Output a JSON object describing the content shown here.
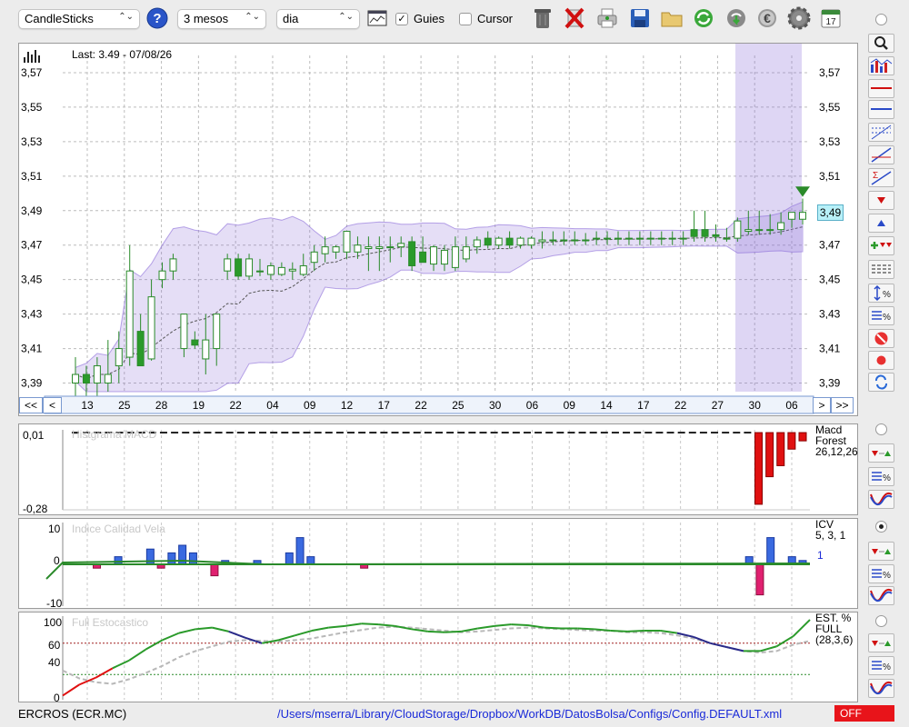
{
  "toolbar": {
    "chart_type": "CandleSticks",
    "period": "3 mesos",
    "interval": "dia",
    "guides_label": "Guies",
    "guides_checked": true,
    "cursor_label": "Cursor",
    "cursor_checked": false,
    "calendar_day": "17",
    "icons": [
      "help-icon",
      "chart-settings-icon",
      "trash-icon",
      "delete-icon",
      "print-icon",
      "save-icon",
      "folder-icon",
      "refresh-icon",
      "download-icon",
      "euro-icon",
      "gear-icon",
      "calendar-icon"
    ]
  },
  "main_chart": {
    "last_label": "Last: 3.49 - 07/08/26",
    "current_price": "3,49",
    "nav": {
      "first": "<<",
      "prev": "<",
      "next": ">",
      "last": ">>"
    }
  },
  "chart_data": [
    {
      "type": "candlestick",
      "name": "ERCROS (ECR.MC)",
      "ylim": [
        3.385,
        3.58
      ],
      "y_ticks": [
        "3,57",
        "3,55",
        "3,53",
        "3,51",
        "3,49",
        "3,47",
        "3,45",
        "3,43",
        "3,41",
        "3,39"
      ],
      "x_labels": [
        "13",
        "25",
        "28",
        "19",
        "22",
        "04",
        "09",
        "12",
        "17",
        "22",
        "25",
        "30",
        "06",
        "09",
        "14",
        "17",
        "22",
        "27",
        "30",
        "06"
      ],
      "candles": [
        {
          "o": 3.39,
          "h": 3.405,
          "l": 3.38,
          "c": 3.395
        },
        {
          "o": 3.395,
          "h": 3.4,
          "l": 3.378,
          "c": 3.39
        },
        {
          "o": 3.39,
          "h": 3.405,
          "l": 3.375,
          "c": 3.4
        },
        {
          "o": 3.39,
          "h": 3.415,
          "l": 3.385,
          "c": 3.395
        },
        {
          "o": 3.4,
          "h": 3.42,
          "l": 3.39,
          "c": 3.41
        },
        {
          "o": 3.405,
          "h": 3.47,
          "l": 3.4,
          "c": 3.455
        },
        {
          "o": 3.42,
          "h": 3.43,
          "l": 3.4,
          "c": 3.4
        },
        {
          "o": 3.404,
          "h": 3.45,
          "l": 3.403,
          "c": 3.44
        },
        {
          "o": 3.45,
          "h": 3.46,
          "l": 3.445,
          "c": 3.455
        },
        {
          "o": 3.455,
          "h": 3.465,
          "l": 3.45,
          "c": 3.462
        },
        {
          "o": 3.41,
          "h": 3.43,
          "l": 3.405,
          "c": 3.43
        },
        {
          "o": 3.415,
          "h": 3.42,
          "l": 3.41,
          "c": 3.412
        },
        {
          "o": 3.404,
          "h": 3.43,
          "l": 3.395,
          "c": 3.415
        },
        {
          "o": 3.41,
          "h": 3.43,
          "l": 3.4,
          "c": 3.43
        },
        {
          "o": 3.455,
          "h": 3.465,
          "l": 3.45,
          "c": 3.462
        },
        {
          "o": 3.462,
          "h": 3.465,
          "l": 3.45,
          "c": 3.452
        },
        {
          "o": 3.452,
          "h": 3.465,
          "l": 3.45,
          "c": 3.462
        },
        {
          "o": 3.455,
          "h": 3.462,
          "l": 3.452,
          "c": 3.455
        },
        {
          "o": 3.453,
          "h": 3.46,
          "l": 3.45,
          "c": 3.458
        },
        {
          "o": 3.453,
          "h": 3.46,
          "l": 3.452,
          "c": 3.457
        },
        {
          "o": 3.455,
          "h": 3.46,
          "l": 3.45,
          "c": 3.456
        },
        {
          "o": 3.453,
          "h": 3.465,
          "l": 3.452,
          "c": 3.458
        },
        {
          "o": 3.46,
          "h": 3.47,
          "l": 3.455,
          "c": 3.466
        },
        {
          "o": 3.465,
          "h": 3.475,
          "l": 3.46,
          "c": 3.469
        },
        {
          "o": 3.466,
          "h": 3.47,
          "l": 3.462,
          "c": 3.469
        },
        {
          "o": 3.466,
          "h": 3.475,
          "l": 3.462,
          "c": 3.478
        },
        {
          "o": 3.466,
          "h": 3.475,
          "l": 3.462,
          "c": 3.47
        },
        {
          "o": 3.468,
          "h": 3.475,
          "l": 3.455,
          "c": 3.469
        },
        {
          "o": 3.468,
          "h": 3.475,
          "l": 3.455,
          "c": 3.469
        },
        {
          "o": 3.469,
          "h": 3.475,
          "l": 3.46,
          "c": 3.469
        },
        {
          "o": 3.469,
          "h": 3.475,
          "l": 3.463,
          "c": 3.471
        },
        {
          "o": 3.472,
          "h": 3.475,
          "l": 3.455,
          "c": 3.458
        },
        {
          "o": 3.466,
          "h": 3.475,
          "l": 3.462,
          "c": 3.46
        },
        {
          "o": 3.459,
          "h": 3.47,
          "l": 3.455,
          "c": 3.469
        },
        {
          "o": 3.459,
          "h": 3.47,
          "l": 3.455,
          "c": 3.467
        },
        {
          "o": 3.457,
          "h": 3.475,
          "l": 3.455,
          "c": 3.469
        },
        {
          "o": 3.462,
          "h": 3.475,
          "l": 3.46,
          "c": 3.469
        },
        {
          "o": 3.469,
          "h": 3.475,
          "l": 3.465,
          "c": 3.473
        },
        {
          "o": 3.474,
          "h": 3.478,
          "l": 3.468,
          "c": 3.47
        },
        {
          "o": 3.47,
          "h": 3.475,
          "l": 3.468,
          "c": 3.474
        },
        {
          "o": 3.474,
          "h": 3.478,
          "l": 3.468,
          "c": 3.47
        },
        {
          "o": 3.47,
          "h": 3.475,
          "l": 3.468,
          "c": 3.474
        },
        {
          "o": 3.47,
          "h": 3.475,
          "l": 3.468,
          "c": 3.474
        },
        {
          "o": 3.472,
          "h": 3.478,
          "l": 3.468,
          "c": 3.473
        },
        {
          "o": 3.473,
          "h": 3.478,
          "l": 3.47,
          "c": 3.473
        },
        {
          "o": 3.473,
          "h": 3.478,
          "l": 3.47,
          "c": 3.473
        },
        {
          "o": 3.473,
          "h": 3.478,
          "l": 3.47,
          "c": 3.473
        },
        {
          "o": 3.473,
          "h": 3.477,
          "l": 3.47,
          "c": 3.473
        },
        {
          "o": 3.474,
          "h": 3.478,
          "l": 3.47,
          "c": 3.474
        },
        {
          "o": 3.474,
          "h": 3.478,
          "l": 3.47,
          "c": 3.474
        },
        {
          "o": 3.474,
          "h": 3.478,
          "l": 3.47,
          "c": 3.474
        },
        {
          "o": 3.474,
          "h": 3.478,
          "l": 3.47,
          "c": 3.474
        },
        {
          "o": 3.474,
          "h": 3.478,
          "l": 3.47,
          "c": 3.474
        },
        {
          "o": 3.474,
          "h": 3.478,
          "l": 3.47,
          "c": 3.474
        },
        {
          "o": 3.474,
          "h": 3.478,
          "l": 3.47,
          "c": 3.474
        },
        {
          "o": 3.474,
          "h": 3.478,
          "l": 3.47,
          "c": 3.474
        },
        {
          "o": 3.474,
          "h": 3.478,
          "l": 3.47,
          "c": 3.474
        },
        {
          "o": 3.479,
          "h": 3.49,
          "l": 3.472,
          "c": 3.475
        },
        {
          "o": 3.479,
          "h": 3.49,
          "l": 3.472,
          "c": 3.475
        },
        {
          "o": 3.476,
          "h": 3.482,
          "l": 3.472,
          "c": 3.475
        },
        {
          "o": 3.474,
          "h": 3.48,
          "l": 3.472,
          "c": 3.474
        },
        {
          "o": 3.474,
          "h": 3.486,
          "l": 3.472,
          "c": 3.484
        },
        {
          "o": 3.478,
          "h": 3.49,
          "l": 3.476,
          "c": 3.479
        },
        {
          "o": 3.479,
          "h": 3.49,
          "l": 3.476,
          "c": 3.479
        },
        {
          "o": 3.479,
          "h": 3.488,
          "l": 3.476,
          "c": 3.479
        },
        {
          "o": 3.479,
          "h": 3.489,
          "l": 3.476,
          "c": 3.483
        },
        {
          "o": 3.485,
          "h": 3.489,
          "l": 3.48,
          "c": 3.489
        },
        {
          "o": 3.485,
          "h": 3.497,
          "l": 3.482,
          "c": 3.489
        }
      ],
      "sma_color": "#555555",
      "band_color": "#8a6bd8"
    },
    {
      "type": "bar",
      "name": "Histgrama MACD",
      "legend": [
        "Macd",
        "Forest",
        "26,12,26"
      ],
      "ylim": [
        -0.28,
        0.01
      ],
      "y_ticks": [
        "0,01",
        "-0,28"
      ],
      "values": [
        0,
        0,
        0,
        0,
        0,
        0,
        0,
        0,
        0,
        0,
        0,
        0,
        0,
        0,
        0,
        0,
        0,
        0,
        0,
        0,
        0,
        0,
        0,
        0,
        0,
        0,
        0,
        0,
        0,
        0,
        0,
        0,
        0,
        0,
        0,
        0,
        0,
        0,
        0,
        0,
        0,
        0,
        0,
        0,
        0,
        0,
        0,
        0,
        0,
        0,
        0,
        0,
        0,
        0,
        0,
        0,
        0,
        0,
        0,
        0,
        0,
        0,
        -0.26,
        -0.16,
        -0.12,
        -0.06,
        -0.03
      ]
    },
    {
      "type": "bar",
      "name": "Índice Calidad Vela",
      "legend": [
        "ICV",
        "5, 3, 1"
      ],
      "secondary_label": "1",
      "ylim": [
        -10,
        10
      ],
      "y_ticks": [
        "10",
        "0",
        "-10"
      ],
      "values": [
        0,
        0,
        -1,
        0,
        2,
        0,
        0,
        4,
        -1,
        3,
        5,
        3,
        0,
        -3,
        1,
        0,
        0,
        1,
        0,
        0,
        3,
        7,
        2,
        0,
        0,
        0,
        0,
        -1,
        0,
        0,
        0,
        0,
        0,
        0,
        0,
        0,
        0,
        0,
        0,
        0,
        0,
        0,
        0,
        0,
        0,
        0,
        0,
        0,
        0,
        0,
        0,
        0,
        0,
        0,
        0,
        0,
        0,
        0,
        0,
        0,
        0,
        0,
        0,
        2,
        -8,
        7,
        0,
        2,
        1
      ]
    },
    {
      "type": "line",
      "name": "Full Estocástico",
      "legend": [
        "EST. %",
        "FULL",
        "(28,3,6)"
      ],
      "ylim": [
        0,
        100
      ],
      "y_ticks": [
        "100",
        "60",
        "40",
        "0"
      ],
      "series": [
        {
          "values": [
            3,
            17,
            26,
            38,
            48,
            62,
            74,
            83,
            88,
            90,
            85,
            77,
            70,
            74,
            80,
            86,
            90,
            92,
            95,
            94,
            92,
            88,
            85,
            84,
            85,
            89,
            92,
            94,
            93,
            90,
            89,
            89,
            88,
            86,
            85,
            86,
            86,
            83,
            78,
            70,
            65,
            60,
            60,
            66,
            79,
            100
          ]
        },
        {
          "values": [
            35,
            25,
            20,
            18,
            24,
            32,
            41,
            52,
            60,
            66,
            72,
            74,
            73,
            72,
            74,
            76,
            80,
            84,
            87,
            90,
            91,
            90,
            88,
            86,
            84,
            85,
            87,
            89,
            90,
            89,
            88,
            87,
            86,
            86,
            84,
            84,
            83,
            80,
            76,
            70,
            65,
            60,
            58,
            60,
            68,
            73
          ]
        }
      ]
    }
  ],
  "sub_panels": {
    "macd": {
      "title": "Histgrama MACD",
      "legend1": "Macd",
      "legend2": "Forest",
      "legend3": "26,12,26",
      "ytop": "0,01",
      "ybottom": "-0,28"
    },
    "icv": {
      "title": "Indice Calidad Vela",
      "legend1": "ICV",
      "legend2": "5, 3, 1",
      "extra": "1",
      "ytop": "10",
      "ymid": "0",
      "ybottom": "-10"
    },
    "stoch": {
      "title": "Full Estocastico",
      "legend1": "EST. %",
      "legend2": "FULL",
      "legend3": "(28,3,6)",
      "y100": "100",
      "y60": "60",
      "y40": "40",
      "y0": "0"
    }
  },
  "status": {
    "ticker": "ERCROS (ECR.MC)",
    "path": "/Users/mserra/Library/CloudStorage/Dropbox/WorkDB/DatosBolsa/Configs/Config.DEFAULT.xml",
    "off_label": "OFF"
  }
}
